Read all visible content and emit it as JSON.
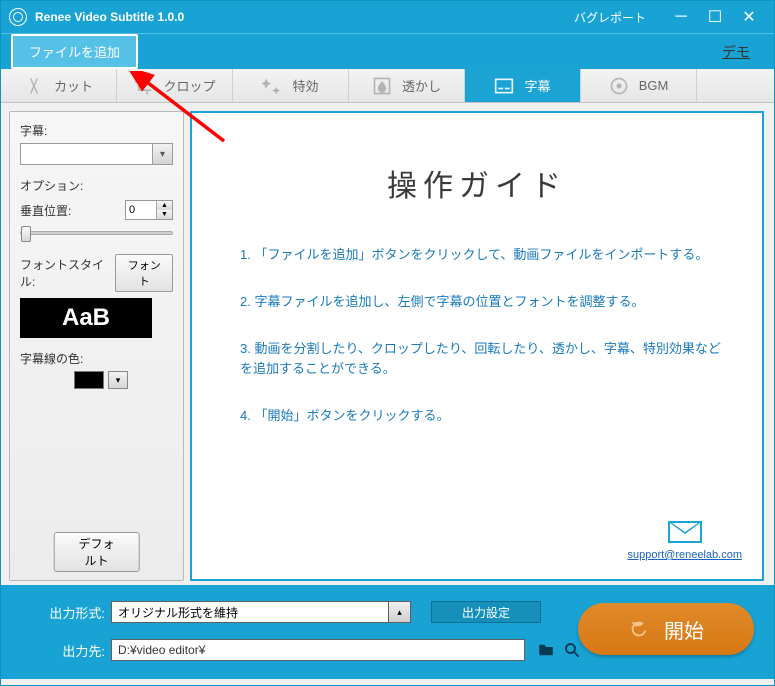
{
  "titlebar": {
    "title": "Renee Video Subtitle 1.0.0",
    "bug_report": "バグレポート"
  },
  "toolbar": {
    "add_file": "ファイルを追加",
    "demo": "デモ"
  },
  "tabs": {
    "cut": "カット",
    "crop": "クロップ",
    "effect": "特効",
    "watermark": "透かし",
    "subtitle": "字幕",
    "bgm": "BGM"
  },
  "sidebar": {
    "subtitle_label": "字幕:",
    "option_label": "オプション:",
    "vpos_label": "垂直位置:",
    "vpos_value": "0",
    "font_style_label": "フォントスタイル:",
    "font_button": "フォント",
    "preview_text": "AaB",
    "line_color_label": "字幕線の色:",
    "default_button": "デフォルト"
  },
  "guide": {
    "title": "操作ガイド",
    "step1": "1. 「ファイルを追加」ボタンをクリックして、動画ファイルをインポートする。",
    "step2": "2. 字幕ファイルを追加し、左側で字幕の位置とフォントを調整する。",
    "step3": "3. 動画を分割したり、クロップしたり、回転したり、透かし、字幕、特別効果などを追加することができる。",
    "step4": "4. 「開始」ボタンをクリックする。",
    "support_link": "support@reneelab.com"
  },
  "bottom": {
    "format_label": "出力形式:",
    "format_value": "オリジナル形式を維持",
    "output_settings": "出力設定",
    "dest_label": "出力先:",
    "dest_value": "D:¥video editor¥",
    "start": "開始"
  }
}
